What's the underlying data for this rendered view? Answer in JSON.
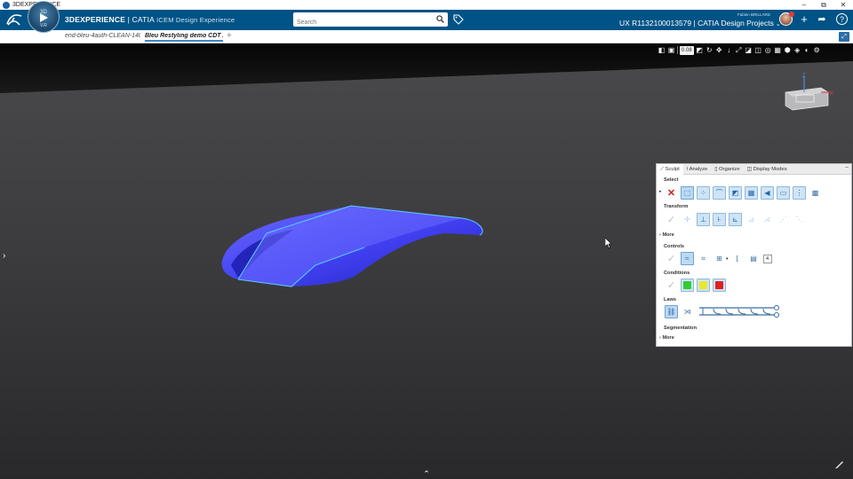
{
  "os_window": {
    "title": "3DEXPERIENCE",
    "controls": [
      "–",
      "⧉",
      "✕"
    ]
  },
  "header": {
    "compass_top": "3D",
    "compass_version": "V.R",
    "brand_bold": "3DEXPERIENCE",
    "brand_rest": " | CATIA",
    "brand_app": "ICEM Design Experience",
    "search_placeholder": "Search",
    "user_name": "Fabien BRILLARD",
    "context_title": "UX R1132100013579 | CATIA Design Projects",
    "context_chevron": "⌄",
    "add_label": "+",
    "share_label": "➦",
    "help_label": "?"
  },
  "tabs": {
    "items": [
      {
        "label": "end-bleu-4auth-CLEAN-140",
        "active": false
      },
      {
        "label": "Bleu Restyling demo CDT A",
        "active": true
      }
    ],
    "add_label": "+",
    "expand_label": "⤢"
  },
  "view_toolbar": {
    "zoom": "0.08",
    "icons": [
      "camera-icon",
      "cube-view-icon",
      "rotate-icon",
      "pan-icon",
      "zoom-icon",
      "fit-all-icon",
      "normal-view-icon",
      "render-style-icon",
      "hide-show-icon",
      "multi-view-icon",
      "view-cube-icon",
      "lights-icon",
      "settings-icon"
    ]
  },
  "viewport": {
    "left_expand": "›",
    "bottom_expand": "⌃",
    "compass_axis_z": "Z",
    "compass_axis_x": "X",
    "surface_colors": {
      "fill": "#3f3ff0",
      "fill_dark": "#2424b8",
      "fill_light": "#6a6aff",
      "edge": "#5cc7ff"
    }
  },
  "panel": {
    "tabs": [
      {
        "label": "Sculpt",
        "icon": "sculpt-icon",
        "active": true
      },
      {
        "label": "Analyze",
        "icon": "analyze-icon",
        "active": false
      },
      {
        "label": "Organize",
        "icon": "organize-icon",
        "active": false
      },
      {
        "label": "Display Modes",
        "icon": "display-modes-icon",
        "active": false
      }
    ],
    "minimize_label": "–",
    "sections": {
      "select": "Select",
      "transform": "Transform",
      "more1": "More",
      "controls": "Controls",
      "conditions": "Conditions",
      "laws": "Laws",
      "segmentation": "Segmentation",
      "more2": "More"
    },
    "controls_count": "4",
    "row_marker": "▸",
    "more_arrow": "›",
    "condition_colors": [
      "#33cc33",
      "#e8e82a",
      "#dd2222"
    ]
  }
}
